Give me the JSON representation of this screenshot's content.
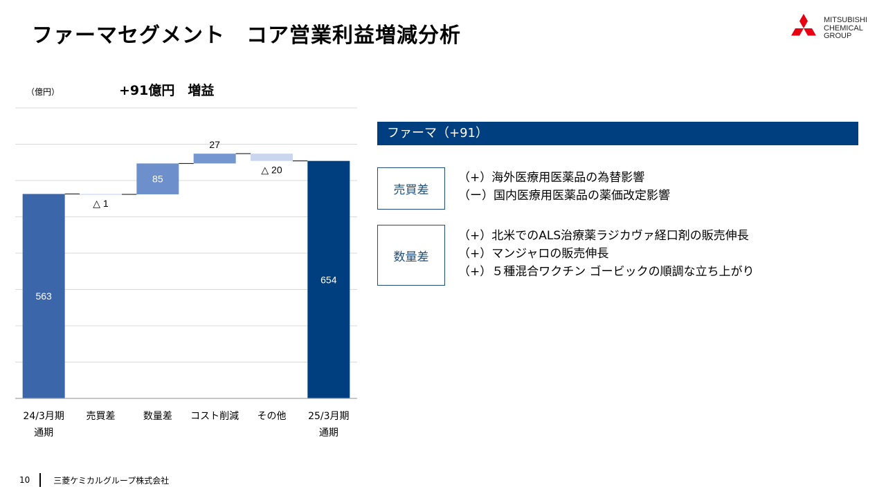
{
  "page": {
    "title": "ファーマセグメント　コア営業利益増減分析",
    "unit_label": "（億円）",
    "headline": "+91億円　増益"
  },
  "logo": {
    "lines": [
      "MITSUBISHI",
      "CHEMICAL",
      "GROUP"
    ],
    "color": "#e60012"
  },
  "chart_data": {
    "type": "bar",
    "subtype": "waterfall",
    "categories": [
      "24/3月期\n通期",
      "売買差",
      "数量差",
      "コスト削減",
      "その他",
      "25/3月期\n通期"
    ],
    "values": [
      563,
      -1,
      85,
      27,
      -20,
      654
    ],
    "kinds": [
      "total",
      "delta",
      "delta",
      "delta",
      "delta",
      "total"
    ],
    "value_labels": [
      "563",
      "△ 1",
      "85",
      "27",
      "△ 20",
      "654"
    ],
    "ylim": [
      0,
      800
    ],
    "grid": true,
    "legend": "none",
    "colors": {
      "start_total": "#3c66aa",
      "end_total": "#003f7f",
      "increase_large": "#6d90cc",
      "increase_small": "#7597cf",
      "decrease": "#c9d6ee"
    }
  },
  "panel": {
    "banner": "ファーマ（+91）",
    "groups": [
      {
        "label": "売買差",
        "items": [
          "（+）海外医療用医薬品の為替影響",
          "（ー）国内医療用医薬品の薬価改定影響"
        ]
      },
      {
        "label": "数量差",
        "items": [
          "（+）北米でのALS治療薬ラジカヴァ経口剤の販売伸長",
          "（+）マンジャロの販売伸長",
          "（+）５種混合ワクチン ゴービックの順調な立ち上がり"
        ]
      }
    ]
  },
  "footer": {
    "page_number": "10",
    "company": "三菱ケミカルグループ株式会社"
  }
}
